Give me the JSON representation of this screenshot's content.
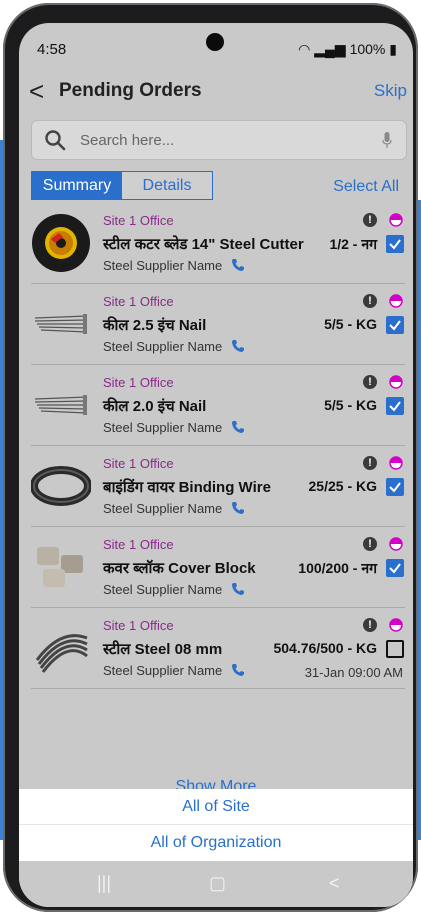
{
  "status_bar": {
    "time": "4:58",
    "battery": "100%"
  },
  "header": {
    "back": "<",
    "title": "Pending Orders",
    "skip": "Skip"
  },
  "search": {
    "placeholder": "Search here..."
  },
  "tabs": {
    "summary": "Summary",
    "details": "Details",
    "select_all": "Select All"
  },
  "orders": [
    {
      "site": "Site 1 Office",
      "name": "स्टील कटर ब्लेड 14\" Steel Cutter",
      "qty": "1/2 - नग",
      "supplier": "Steel Supplier Name",
      "checked": true
    },
    {
      "site": "Site 1 Office",
      "name": "कील 2.5 इंच Nail",
      "qty": "5/5 - KG",
      "supplier": "Steel Supplier Name",
      "checked": true
    },
    {
      "site": "Site 1 Office",
      "name": "कील 2.0 इंच Nail",
      "qty": "5/5 - KG",
      "supplier": "Steel Supplier Name",
      "checked": true
    },
    {
      "site": "Site 1 Office",
      "name": "बाइंडिंग वायर Binding Wire",
      "qty": "25/25 - KG",
      "supplier": "Steel Supplier Name",
      "checked": true
    },
    {
      "site": "Site 1 Office",
      "name": "कवर ब्लॉक Cover Block",
      "qty": "100/200 - नग",
      "supplier": "Steel Supplier Name",
      "checked": true
    },
    {
      "site": "Site 1 Office",
      "name": "स्टील Steel 08 mm",
      "qty": "504.76/500 - KG",
      "supplier": "Steel Supplier Name",
      "checked": false,
      "date": "31-Jan 09:00 AM"
    }
  ],
  "show_more": "Show More",
  "sheet": {
    "all_site": "All of Site",
    "all_org": "All of Organization"
  },
  "colors": {
    "accent": "#2a6fcb",
    "site": "#8a2a8a",
    "half_icon": "#d400c8"
  }
}
